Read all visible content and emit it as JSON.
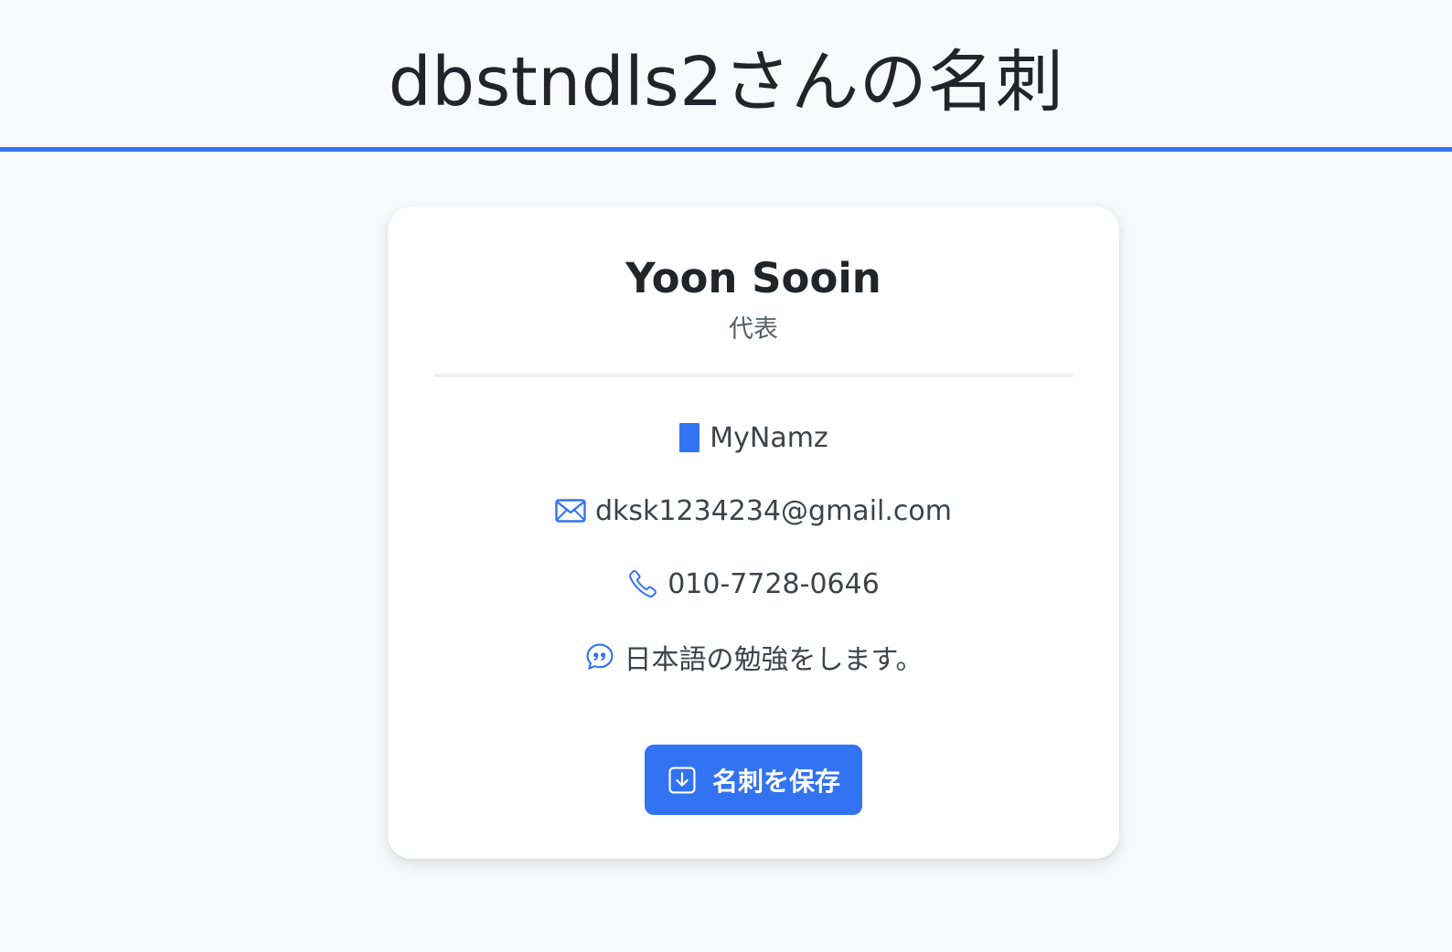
{
  "header": {
    "title": "dbstndls2さんの名刺"
  },
  "card": {
    "name": "Yoon Sooin",
    "role": "代表",
    "company": "MyNamz",
    "email": "dksk1234234@gmail.com",
    "phone": "010-7728-0646",
    "bio": "日本語の勉強をします。",
    "save_label": "名刺を保存"
  },
  "icons": {
    "company": "building-icon",
    "email": "envelope-icon",
    "phone": "phone-icon",
    "bio": "quote-bubble-icon",
    "save": "download-icon"
  },
  "colors": {
    "accent": "#3273f1",
    "background": "#f8f9fa",
    "card": "#ffffff",
    "text": "#212529",
    "muted": "#3d4349"
  }
}
